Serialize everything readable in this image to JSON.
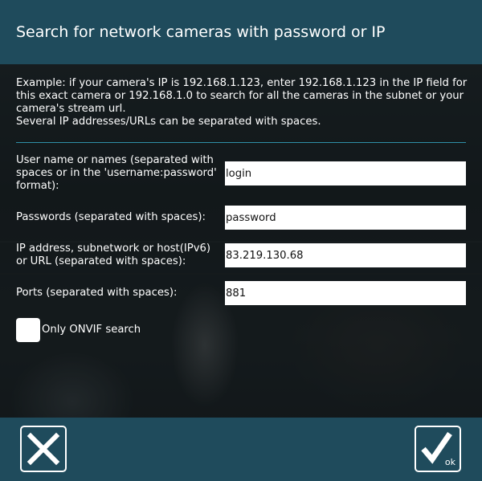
{
  "dialog": {
    "title": "Search for network cameras with password or IP",
    "intro_lines": [
      "Example: if your camera's IP is 192.168.1.123, enter 192.168.1.123 in the IP field for",
      "this exact camera or 192.168.1.0 to search for all the cameras in the subnet or your",
      "camera's stream url.",
      "Several IP addresses/URLs can be separated with spaces."
    ]
  },
  "fields": {
    "username": {
      "label_lines": [
        "User name or names (separated with",
        "spaces or in the 'username:password'",
        "format):"
      ],
      "value": "login"
    },
    "passwords": {
      "label_lines": [
        "Passwords (separated with spaces):"
      ],
      "value": "password"
    },
    "ip": {
      "label_lines": [
        "IP address, subnetwork or host(IPv6)",
        "or URL (separated with spaces):"
      ],
      "value": "83.219.130.68"
    },
    "ports": {
      "label_lines": [
        "Ports (separated with spaces):"
      ],
      "value": "881"
    }
  },
  "onvif": {
    "label": "Only ONVIF search",
    "checked": false
  },
  "footer": {
    "cancel_icon": "close-icon",
    "ok_icon": "checkmark-icon",
    "ok_label": "ok"
  },
  "colors": {
    "header_bg": "#1f4b5c",
    "separator": "#2f8fa8"
  }
}
